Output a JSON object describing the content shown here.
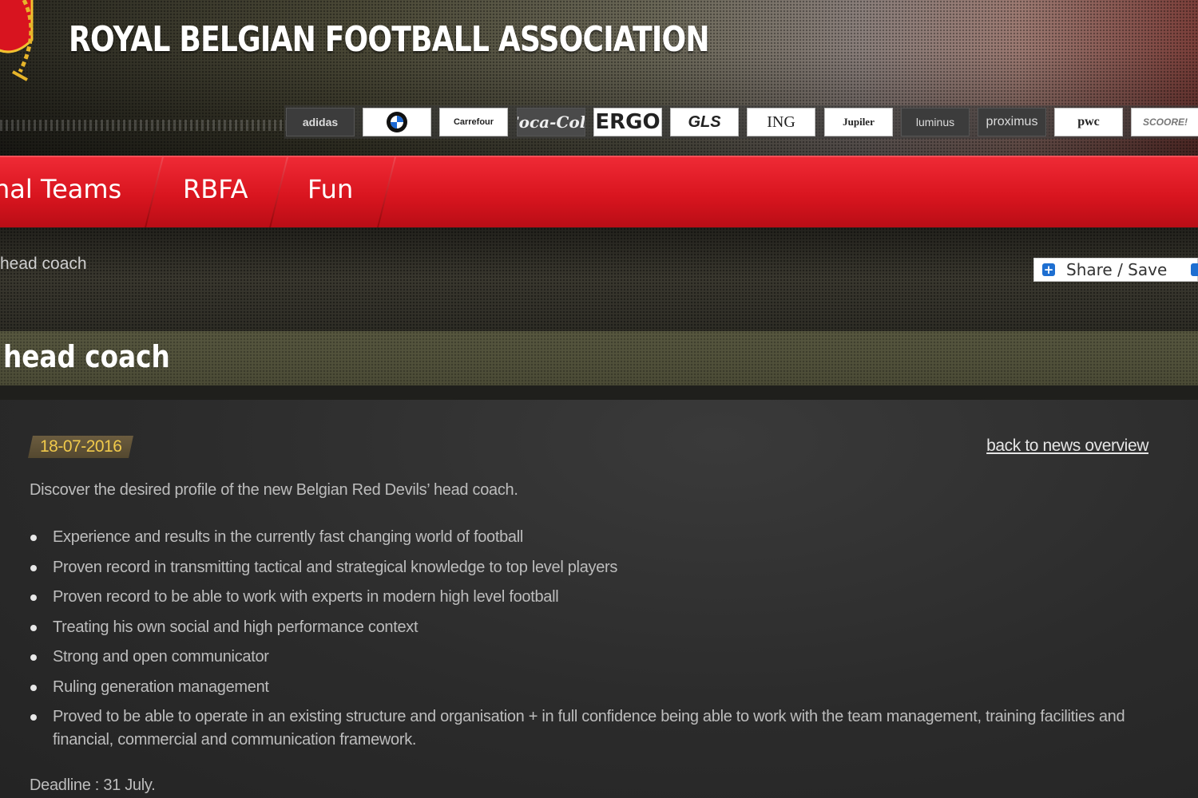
{
  "header": {
    "site_title": "ROYAL BELGIAN FOOTBALL ASSOCIATION",
    "crest_icon": "rbfa-crest-icon",
    "sponsors": [
      {
        "name": "adidas",
        "style": "dark"
      },
      {
        "name": "BMW",
        "style": "light"
      },
      {
        "name": "Carrefour",
        "style": "light"
      },
      {
        "name": "Coca-Cola",
        "style": "script"
      },
      {
        "name": "ERGO",
        "style": "big"
      },
      {
        "name": "GLS",
        "style": "light"
      },
      {
        "name": "ING",
        "style": "light"
      },
      {
        "name": "Jupiler",
        "style": "light"
      },
      {
        "name": "luminus",
        "style": "dark"
      },
      {
        "name": "proximus",
        "style": "dark"
      },
      {
        "name": "pwc",
        "style": "light"
      },
      {
        "name": "SCOORE!",
        "style": "light"
      }
    ]
  },
  "nav": {
    "items": [
      {
        "label": "nal Teams"
      },
      {
        "label": "RBFA"
      },
      {
        "label": "Fun"
      }
    ]
  },
  "breadcrumb": {
    "text": "head coach"
  },
  "share": {
    "label": "Share / Save"
  },
  "article": {
    "title": "head coach",
    "date": "18-07-2016",
    "back_link": "back to news overview",
    "intro": "Discover the desired profile of the new Belgian Red Devils’ head coach.",
    "requirements": [
      "Experience and results in the currently fast changing world of football",
      "Proven record in transmitting tactical and strategical knowledge to top level players",
      "Proven record to be able to work with experts in modern high level football",
      "Treating his own social and high performance context",
      "Strong and open communicator",
      "Ruling generation management",
      "Proved to be able to operate in an existing structure and organisation + in full confidence being able to work with the team management, training facilities and financial, commercial and communication framework."
    ],
    "deadline": "Deadline : 31 July."
  },
  "colors": {
    "nav_red": "#d9151f",
    "date_yellow": "#f0c94b",
    "title_band": "#4b4b36",
    "content_bg": "#2b2b2b",
    "share_blue": "#1e6fd1"
  }
}
